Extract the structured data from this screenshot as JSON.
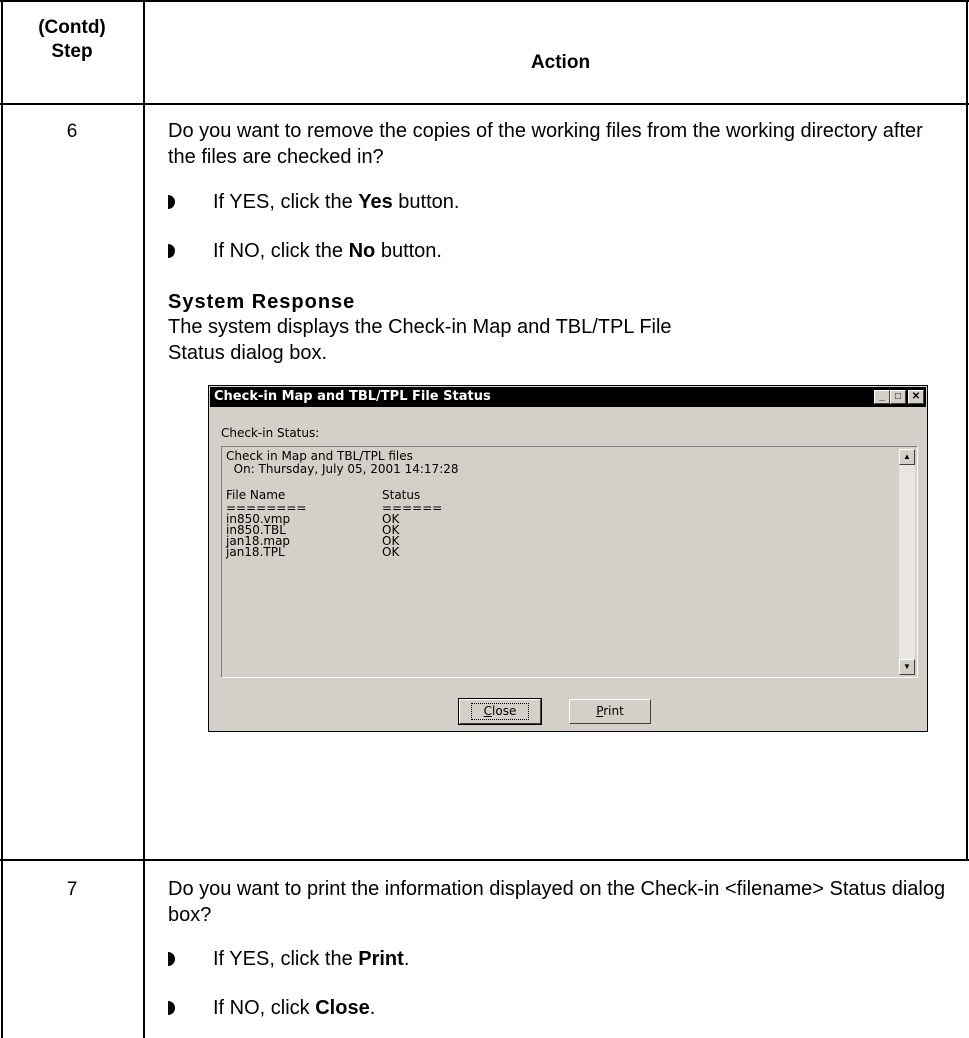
{
  "table": {
    "header_step_line1": "(Contd)",
    "header_step_line2": "Step",
    "header_action": "Action"
  },
  "step6": {
    "number": "6",
    "question": "Do you want to remove the copies of the working files from the working directory after the files are checked in?",
    "bullet1": {
      "prefix": "If YES, click the ",
      "bold": "Yes",
      "suffix": " button."
    },
    "bullet2": {
      "prefix": "If NO, click the ",
      "bold": "No",
      "suffix": " button."
    },
    "system_response_heading": "System Response",
    "system_response_text": "The system displays the Check-in Map and TBL/TPL File Status dialog box."
  },
  "dialog": {
    "title": "Check-in Map and TBL/TPL File Status",
    "status_label": "Check-in Status:",
    "log_header_line1": "Check in Map and TBL/TPL files",
    "log_header_line2": "  On: Thursday, July 05, 2001 14:17:28",
    "col_file_name": "File Name",
    "col_status": "Status",
    "col_file_sep": "========",
    "col_status_sep": "======",
    "rows": [
      {
        "file": "in850.vmp",
        "status": "OK"
      },
      {
        "file": "in850.TBL",
        "status": "OK"
      },
      {
        "file": "jan18.map",
        "status": "OK"
      },
      {
        "file": "jan18.TPL",
        "status": "OK"
      }
    ],
    "close_button": {
      "accel": "C",
      "rest": "lose"
    },
    "print_button": {
      "accel": "P",
      "rest": "rint"
    }
  },
  "step7": {
    "number": "7",
    "question": "Do you want to print the information displayed on the Check-in <filename> Status dialog box?",
    "bullet1": {
      "prefix": "If YES, click the ",
      "bold": "Print",
      "suffix": "."
    },
    "bullet2": {
      "prefix": "If NO, click ",
      "bold": "Close",
      "suffix": "."
    }
  }
}
